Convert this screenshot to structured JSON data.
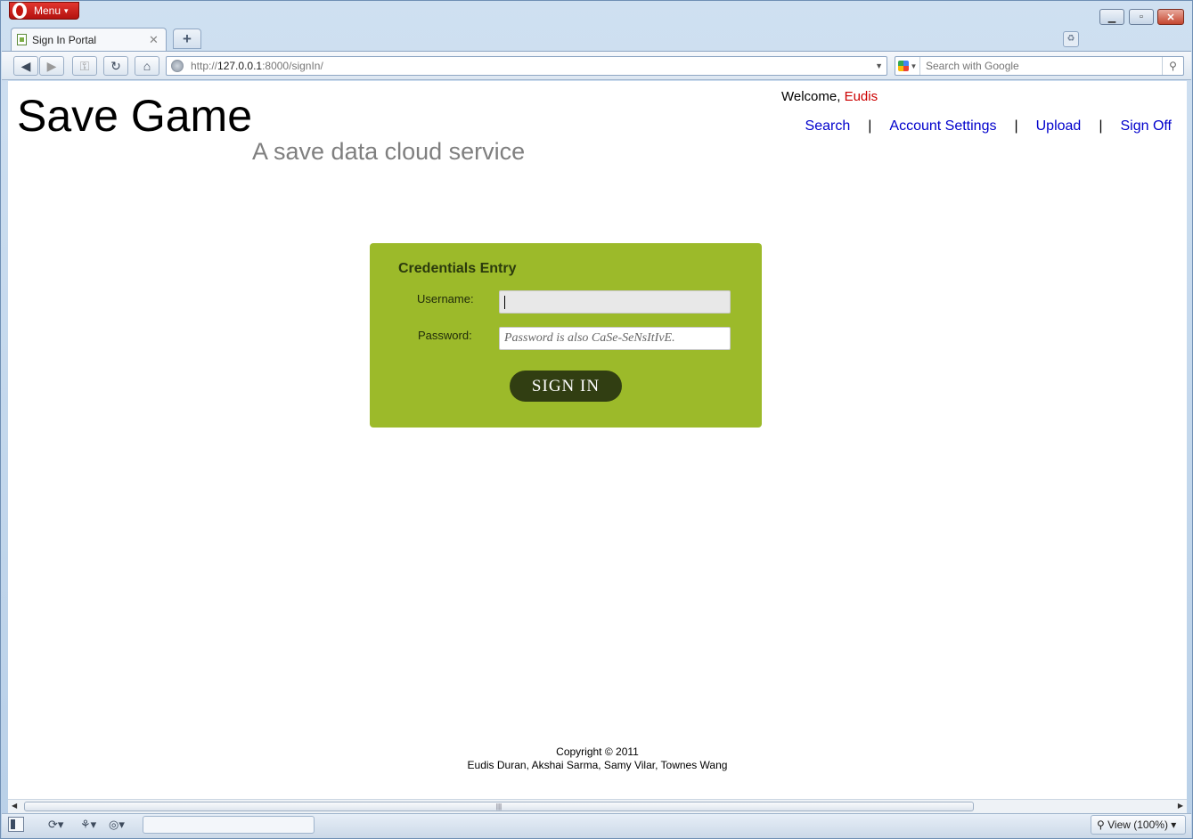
{
  "browser": {
    "menu_label": "Menu",
    "tab_title": "Sign In Portal",
    "tab_close": "✕",
    "new_tab": "+",
    "url_scheme": "http://",
    "url_host": "127.0.0.1",
    "url_rest": ":8000/signIn/",
    "search_placeholder": "Search with Google",
    "view_zoom": "View (100%)"
  },
  "site": {
    "title": "Save Game",
    "subtitle": "A save data cloud service",
    "welcome_prefix": "Welcome, ",
    "username": "Eudis",
    "nav": [
      {
        "label": "Search"
      },
      {
        "label": "Account Settings"
      },
      {
        "label": "Upload"
      },
      {
        "label": "Sign Off"
      }
    ],
    "nav_separator": "|"
  },
  "login": {
    "heading": "Credentials Entry",
    "username_label": "Username:",
    "password_label": "Password:",
    "username_value": "",
    "password_placeholder": "Password is also CaSe-SeNsItIvE.",
    "submit_label": "SIGN IN",
    "box_color": "#9cba2a",
    "button_color": "#313e12"
  },
  "footer": {
    "copyright": "Copyright © 2011",
    "authors": "Eudis Duran, Akshai Sarma, Samy Vilar, Townes Wang"
  }
}
